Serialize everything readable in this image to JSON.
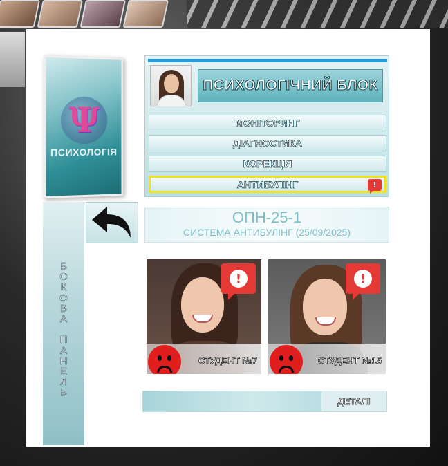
{
  "header": {
    "title": "ПСИХОЛОГІЧНИЙ БЛОК"
  },
  "logo": {
    "glyph": "Ψ",
    "text": "ПСИХОЛОГІЯ"
  },
  "menu": {
    "items": [
      {
        "label": "МОНІТОРИНГ"
      },
      {
        "label": "ДІАГНОСТИКА"
      },
      {
        "label": "КОРЕКЦІЯ"
      },
      {
        "label": "АНТИБУЛІНГ",
        "active": true,
        "alert_glyph": "!"
      }
    ]
  },
  "side_panel": {
    "label": "БОКОВА ПАНЕЛЬ"
  },
  "class_info": {
    "code": "ОПН-25-1",
    "subtitle": "СИСТЕМА АНТИБУЛІНГ (25/09/2025)"
  },
  "students": [
    {
      "name": "СТУДЕНТ №7",
      "alert_glyph": "!",
      "mood": "sad"
    },
    {
      "name": "СТУДЕНТ №15",
      "alert_glyph": "!",
      "mood": "sad"
    }
  ],
  "details": {
    "label": "ДЕТАЛІ"
  },
  "colors": {
    "accent": "#2a9bd4",
    "alert": "#e53935",
    "highlight": "#f2e21a",
    "teal": "#5fb3bd"
  }
}
